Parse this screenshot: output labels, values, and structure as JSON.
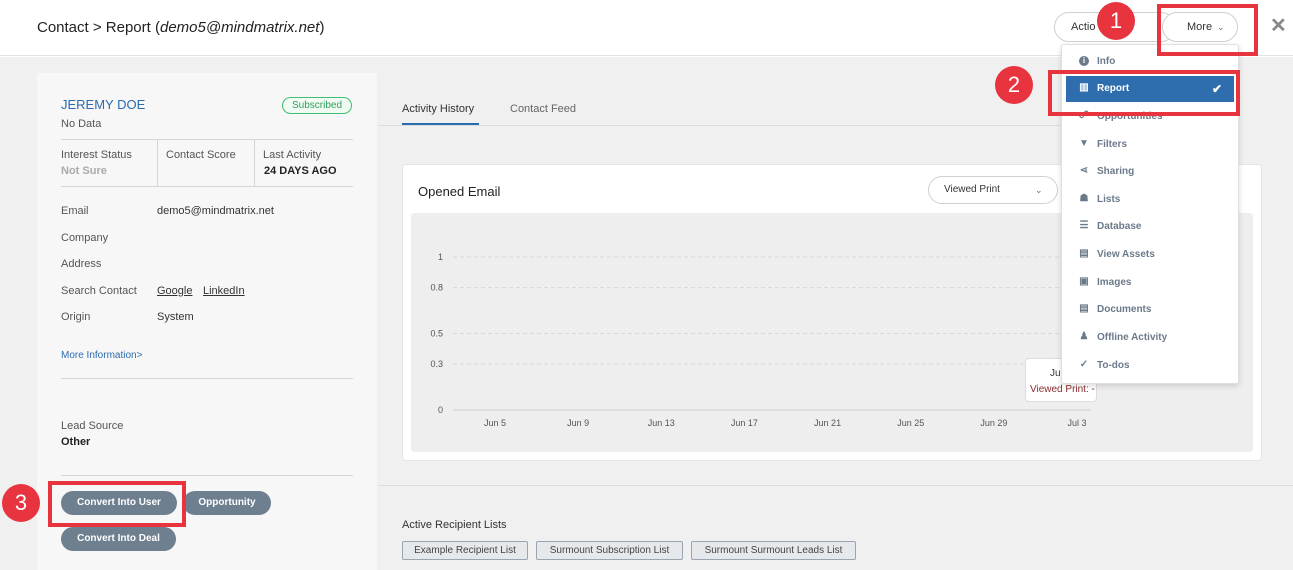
{
  "header": {
    "title_prefix": "Contact > Report (",
    "title_email": "demo5@mindmatrix.net",
    "title_suffix": ")",
    "actions_label": "Actio",
    "more_label": "More",
    "close_glyph": "✕"
  },
  "contact": {
    "name": "JEREMY DOE",
    "sub": "No Data",
    "status_badge": "Subscribed",
    "interest_status_label": "Interest Status",
    "interest_status_value": "Not Sure",
    "contact_score_label": "Contact Score",
    "last_activity_label": "Last Activity",
    "last_activity_value": "24 DAYS AGO",
    "email_label": "Email",
    "email_value": "demo5@mindmatrix.net",
    "company_label": "Company",
    "address_label": "Address",
    "search_contact_label": "Search Contact",
    "search_links": [
      "Google",
      "LinkedIn"
    ],
    "origin_label": "Origin",
    "origin_value": "System",
    "more_info_label": "More Information>",
    "lead_source_label": "Lead Source",
    "lead_source_value": "Other",
    "convert_user_label": "Convert Into User",
    "opportunity_label": "Opportunity",
    "convert_deal_label": "Convert Into Deal"
  },
  "tabs": [
    "Activity History",
    "Contact Feed"
  ],
  "card": {
    "title": "Opened Email",
    "select_value": "Viewed Print",
    "tooltip_title": "Ju",
    "tooltip_line": "Viewed Print: -"
  },
  "chart_data": {
    "type": "line",
    "title": "Opened Email",
    "y_ticks": [
      "1",
      "0.8",
      "0.5",
      "0.3",
      "0"
    ],
    "x_ticks": [
      "Jun 5",
      "Jun 9",
      "Jun 13",
      "Jun 17",
      "Jun 21",
      "Jun 25",
      "Jun 29",
      "Jul 3"
    ],
    "ylim": [
      0,
      1
    ],
    "series": [],
    "grid": true
  },
  "recipients": {
    "label": "Active Recipient Lists",
    "tags": [
      "Example Recipient List",
      "Surmount Subscription List",
      "Surmount Surmount Leads List"
    ]
  },
  "menu": {
    "items": [
      {
        "label": "Info",
        "icon": "info-icon"
      },
      {
        "label": "Report",
        "icon": "chart-icon"
      },
      {
        "label": "Opportunities",
        "icon": "handshake-icon"
      },
      {
        "label": "Filters",
        "icon": "filter-icon"
      },
      {
        "label": "Sharing",
        "icon": "share-icon"
      },
      {
        "label": "Lists",
        "icon": "users-icon"
      },
      {
        "label": "Database",
        "icon": "database-icon"
      },
      {
        "label": "View Assets",
        "icon": "file-icon"
      },
      {
        "label": "Images",
        "icon": "image-icon"
      },
      {
        "label": "Documents",
        "icon": "document-icon"
      },
      {
        "label": "Offline Activity",
        "icon": "person-icon"
      },
      {
        "label": "To-dos",
        "icon": "check-circle-icon"
      }
    ],
    "active_index": 1
  },
  "annotations": [
    "1",
    "2",
    "3"
  ],
  "colors": {
    "accent": "#2f6eae",
    "annotation": "#e8343f",
    "badge_green": "#3fbf6f"
  }
}
